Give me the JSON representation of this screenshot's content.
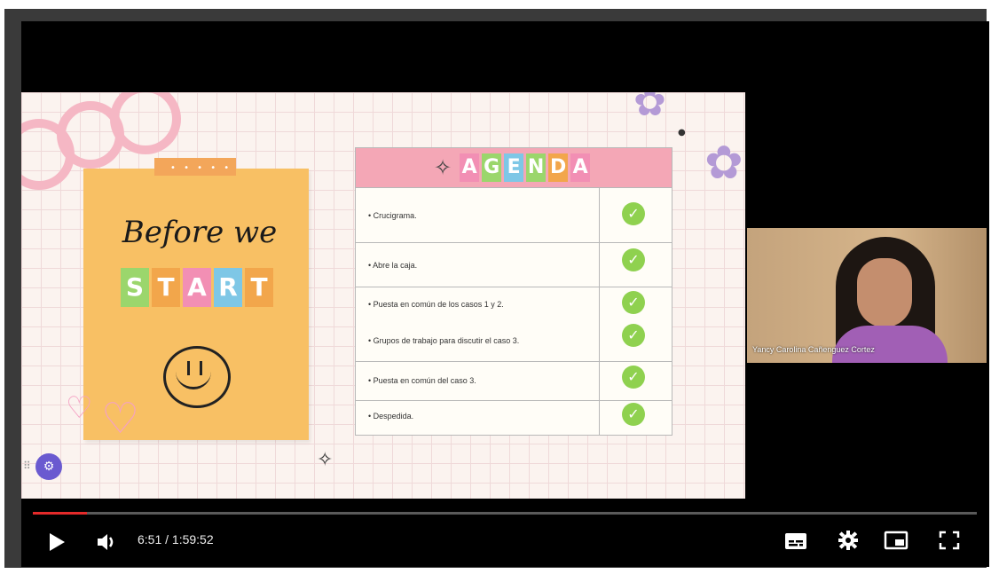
{
  "slide": {
    "before_text": "Before we",
    "start_letters": [
      "S",
      "T",
      "A",
      "R",
      "T"
    ],
    "start_colors": [
      "#9bd66c",
      "#f2a64b",
      "#f28fb4",
      "#7ec7e6",
      "#f2a64b"
    ],
    "agenda": {
      "title_letters": [
        "A",
        "G",
        "E",
        "N",
        "D",
        "A"
      ],
      "title_colors": [
        "#f28fb4",
        "#9bd66c",
        "#7ec7e6",
        "#9bd66c",
        "#f2a64b",
        "#f28fb4"
      ],
      "items": [
        "• Crucigrama.",
        "• Abre la caja.",
        "• Puesta en común de los casos 1 y 2.",
        "•  Grupos de trabajo para discutir el caso 3.",
        "• Puesta en común del caso 3.",
        "• Despedida."
      ]
    }
  },
  "webcam": {
    "name": "Yancy Carolina Cañenguez Cortez"
  },
  "player": {
    "time_display": "6:51 / 1:59:52",
    "progress_fraction": 0.057,
    "progress_color": "#e42a2a",
    "icons": [
      "play-icon",
      "volume-icon",
      "subtitles-icon",
      "settings-icon",
      "miniplayer-icon",
      "fullscreen-icon"
    ]
  }
}
